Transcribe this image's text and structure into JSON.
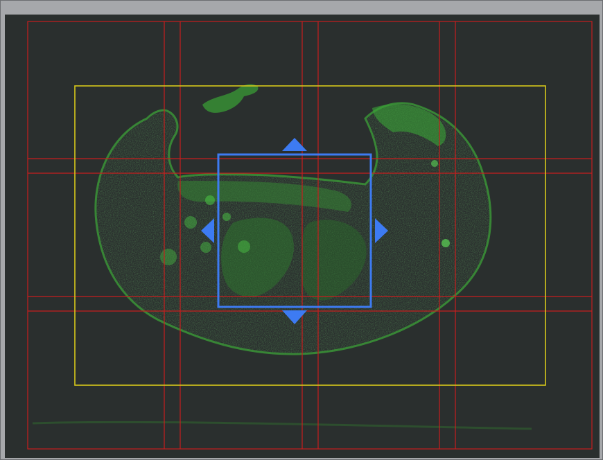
{
  "viewer": {
    "window_background": "#a6a8ab",
    "viewport_background": "#2a2f2e"
  },
  "overlay_colors": {
    "tile_grid": "#c81e1e",
    "scan_area": "#d7c81b",
    "selection": "#3d7bf2",
    "tissue": "#2f8a2e"
  },
  "tile_grid": {
    "columns": 4,
    "rows": 3
  },
  "icons": {
    "move_up": "triangle-up-icon",
    "move_down": "triangle-down-icon",
    "move_left": "triangle-left-icon",
    "move_right": "triangle-right-icon"
  }
}
